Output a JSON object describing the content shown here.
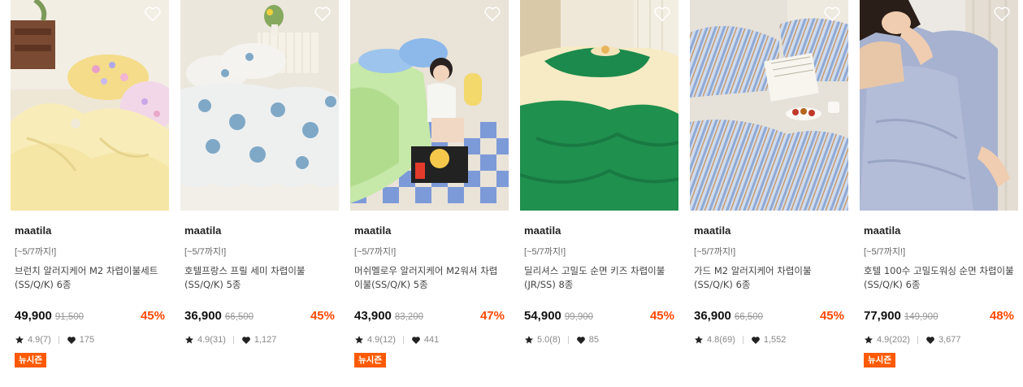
{
  "products": [
    {
      "brand": "maatila",
      "promo": "[~5/7까지!]",
      "title": "브런치 알러지케어 M2 차렵이불세트(SS/Q/K) 6종",
      "price": "49,900",
      "original_price": "91,500",
      "discount": "45%",
      "rating": "4.9(7)",
      "likes": "175",
      "badge": "뉴시즌",
      "image": "yellow-floral-bedding"
    },
    {
      "brand": "maatila",
      "promo": "[~5/7까지!]",
      "title": "호텔프랑스 프릴 세미 차렵이불(SS/Q/K) 5종",
      "price": "36,900",
      "original_price": "66,500",
      "discount": "45%",
      "rating": "4.9(31)",
      "likes": "1,127",
      "badge": "",
      "image": "blue-toile-bedding"
    },
    {
      "brand": "maatila",
      "promo": "[~5/7까지!]",
      "title": "머쉬멜로우 알러지케어 M2워셔 차렵이불(SS/Q/K) 5종",
      "price": "43,900",
      "original_price": "83,200",
      "discount": "47%",
      "rating": "4.9(12)",
      "likes": "441",
      "badge": "뉴시즌",
      "image": "green-comforter-girl"
    },
    {
      "brand": "maatila",
      "promo": "[~5/7까지!]",
      "title": "딜리셔스 고밀도 순면 키즈 차렵이불(JR/SS) 8종",
      "price": "54,900",
      "original_price": "99,900",
      "discount": "45%",
      "rating": "5.0(8)",
      "likes": "85",
      "badge": "",
      "image": "green-cream-bedding"
    },
    {
      "brand": "maatila",
      "promo": "[~5/7까지!]",
      "title": "가드 M2 알러지케어 차렵이불(SS/Q/K) 6종",
      "price": "36,900",
      "original_price": "66,500",
      "discount": "45%",
      "rating": "4.8(69)",
      "likes": "1,552",
      "badge": "",
      "image": "blue-stripe-bedding"
    },
    {
      "brand": "maatila",
      "promo": "[~5/7까지!]",
      "title": "호텔 100수 고밀도워싱 순면 차렵이불(SS/Q/K) 6종",
      "price": "77,900",
      "original_price": "149,900",
      "discount": "48%",
      "rating": "4.9(202)",
      "likes": "3,677",
      "badge": "뉴시즌",
      "image": "lavender-bedding-person"
    }
  ],
  "colors": {
    "discount": "#ff4800",
    "badge": "#ff5a00"
  },
  "icons": {
    "wishlist": "heart-outline-icon",
    "rating": "star-icon",
    "likes": "heart-filled-icon"
  }
}
